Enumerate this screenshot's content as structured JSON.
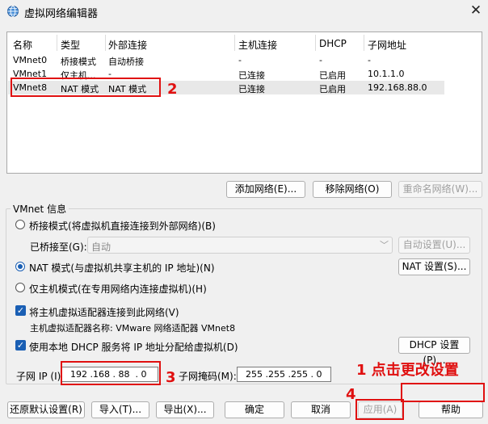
{
  "window": {
    "title": "虚拟网络编辑器",
    "app_icon": "globe-network-icon",
    "close_symbol": "✕"
  },
  "table": {
    "headers": [
      "名称",
      "类型",
      "外部连接",
      "主机连接",
      "DHCP",
      "子网地址"
    ],
    "rows": [
      [
        "VMnet0",
        "桥接模式",
        "自动桥接",
        "-",
        "-",
        "-"
      ],
      [
        "VMnet1",
        "仅主机...",
        "-",
        "已连接",
        "已启用",
        "10.1.1.0"
      ],
      [
        "VMnet8",
        "NAT 模式",
        "NAT 模式",
        "已连接",
        "已启用",
        "192.168.88.0"
      ]
    ],
    "selected_row": "VMnet8"
  },
  "net_buttons": {
    "add": "添加网络(E)...",
    "remove": "移除网络(O)",
    "rename": "重命名网络(W)..."
  },
  "vmnet_info": {
    "title": "VMnet 信息",
    "bridge_mode": "桥接模式(将虚拟机直接连接到外部网络)(B)",
    "bridged_to_label": "已桥接至(G):",
    "bridged_to_value": "自动",
    "auto_settings": "自动设置(U)...",
    "nat_mode": "NAT 模式(与虚拟机共享主机的 IP 地址)(N)",
    "nat_settings": "NAT 设置(S)...",
    "host_only": "仅主机模式(在专用网络内连接虚拟机)(H)",
    "connect_adapter": "将主机虚拟适配器连接到此网络(V)",
    "adapter_name": "主机虚拟适配器名称: VMware 网络适配器 VMnet8",
    "use_dhcp": "使用本地 DHCP 服务将 IP 地址分配给虚拟机(D)",
    "dhcp_settings": "DHCP 设置(P)...",
    "subnet_ip_label": "子网 IP (I):",
    "subnet_ip": "192 .168 . 88  . 0",
    "subnet_mask_label": "子网掩码(M):",
    "subnet_mask": "255 .255 .255 . 0"
  },
  "bottom_buttons": {
    "restore": "还原默认设置(R)",
    "import": "导入(T)...",
    "export": "导出(X)...",
    "ok": "确定",
    "cancel": "取消",
    "apply": "应用(A)",
    "help": "帮助"
  },
  "annotations": {
    "n1": "1 点击更改设置",
    "n2": "2",
    "n3": "3",
    "n4": "4",
    "color": "#e01010"
  }
}
